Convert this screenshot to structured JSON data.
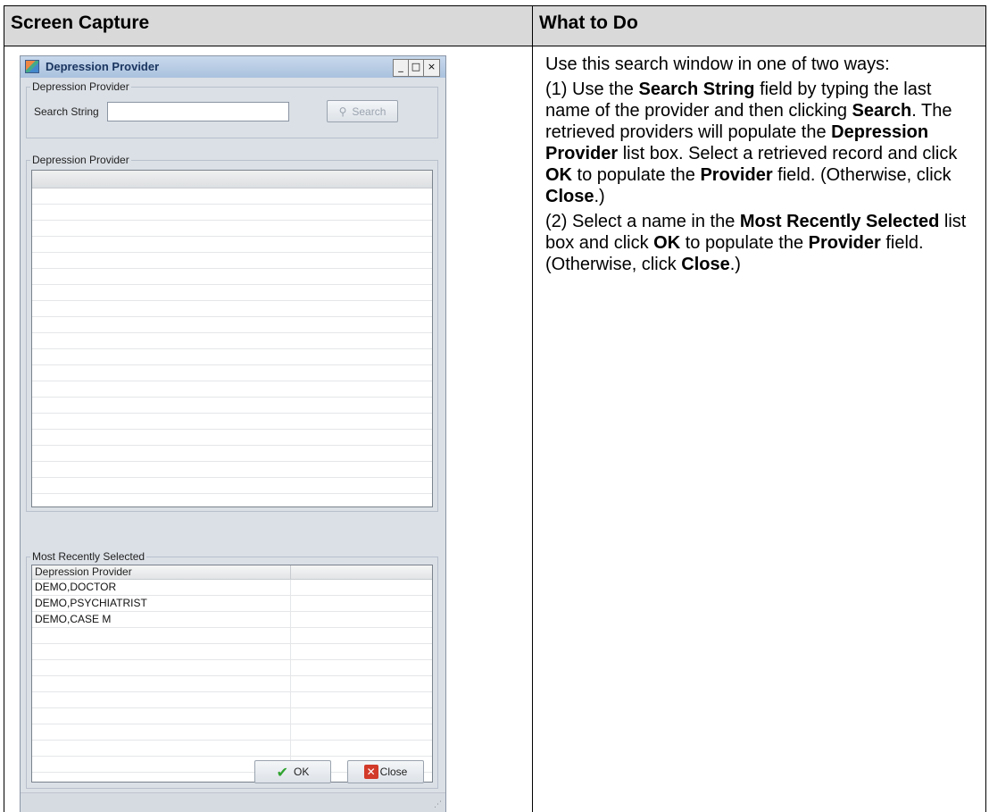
{
  "table": {
    "headers": [
      "Screen Capture",
      "What to Do"
    ]
  },
  "dialog": {
    "title": "Depression Provider",
    "controls": {
      "minimize": "_",
      "maximize": "□",
      "close": "×"
    },
    "search_group": {
      "label": "Depression Provider",
      "search_label": "Search String",
      "search_value": "",
      "search_button": "Search"
    },
    "results_group": {
      "label": "Depression Provider"
    },
    "recent_group": {
      "label": "Most Recently Selected",
      "column_header": "Depression Provider",
      "rows": [
        "DEMO,DOCTOR",
        "DEMO,PSYCHIATRIST",
        "DEMO,CASE M"
      ]
    },
    "buttons": {
      "ok": "OK",
      "close": "Close"
    }
  },
  "instructions": {
    "p1": "Use this search window in one of two ways:",
    "p2": [
      {
        "t": "(1) Use the "
      },
      {
        "t": "Search String",
        "b": true
      },
      {
        "t": " field by typing the last name of the provider and then clicking "
      },
      {
        "t": "Search",
        "b": true
      },
      {
        "t": ". The retrieved providers will populate the "
      },
      {
        "t": "Depression Provider",
        "b": true
      },
      {
        "t": " list box. Select a retrieved record and click "
      },
      {
        "t": "OK",
        "b": true
      },
      {
        "t": " to populate the "
      },
      {
        "t": "Provider",
        "b": true
      },
      {
        "t": " field. (Otherwise, click "
      },
      {
        "t": "Close",
        "b": true
      },
      {
        "t": ".)"
      }
    ],
    "p3": [
      {
        "t": "(2) Select a name in the "
      },
      {
        "t": "Most Recently Selected",
        "b": true
      },
      {
        "t": " list box and click "
      },
      {
        "t": "OK",
        "b": true
      },
      {
        "t": " to populate the "
      },
      {
        "t": "Provider",
        "b": true
      },
      {
        "t": " field. (Otherwise, click "
      },
      {
        "t": "Close",
        "b": true
      },
      {
        "t": ".)"
      }
    ]
  }
}
